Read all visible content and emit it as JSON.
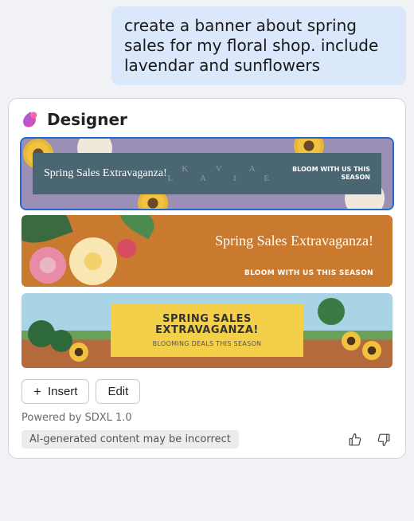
{
  "chat": {
    "user_message": "create a banner about spring sales for my floral shop. include lavendar and sunflowers"
  },
  "card": {
    "app_name": "Designer"
  },
  "banners": [
    {
      "title": "Spring Sales Extravaganza!",
      "watermark": "K   V   A   L   A   I   E",
      "tagline": "BLOOM WITH US THIS SEASON",
      "selected": true
    },
    {
      "title": "Spring Sales Extravaganza!",
      "tagline": "BLOOM WITH US THIS SEASON",
      "selected": false
    },
    {
      "title": "SPRING SALES EXTRAVAGANZA!",
      "tagline": "BLOOMING DEALS THIS SEASON",
      "selected": false
    }
  ],
  "actions": {
    "insert_label": "Insert",
    "edit_label": "Edit"
  },
  "meta": {
    "powered_by": "Powered by SDXL 1.0",
    "disclaimer": "AI-generated content may be incorrect"
  }
}
